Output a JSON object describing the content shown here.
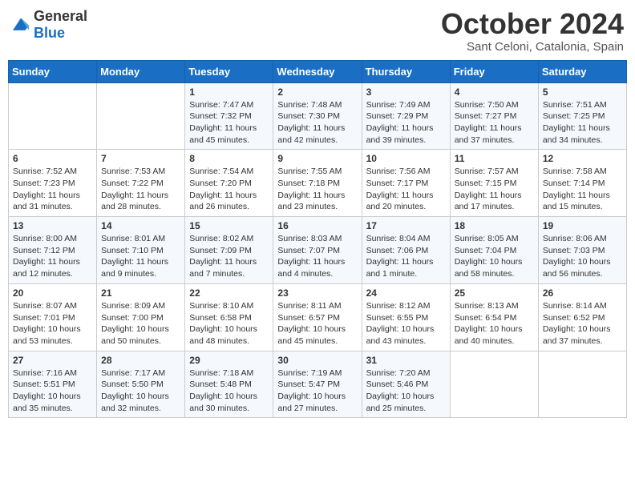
{
  "header": {
    "logo": {
      "general": "General",
      "blue": "Blue"
    },
    "month": "October 2024",
    "location": "Sant Celoni, Catalonia, Spain"
  },
  "weekdays": [
    "Sunday",
    "Monday",
    "Tuesday",
    "Wednesday",
    "Thursday",
    "Friday",
    "Saturday"
  ],
  "weeks": [
    [
      {
        "day": "",
        "sunrise": "",
        "sunset": "",
        "daylight": ""
      },
      {
        "day": "",
        "sunrise": "",
        "sunset": "",
        "daylight": ""
      },
      {
        "day": "1",
        "sunrise": "Sunrise: 7:47 AM",
        "sunset": "Sunset: 7:32 PM",
        "daylight": "Daylight: 11 hours and 45 minutes."
      },
      {
        "day": "2",
        "sunrise": "Sunrise: 7:48 AM",
        "sunset": "Sunset: 7:30 PM",
        "daylight": "Daylight: 11 hours and 42 minutes."
      },
      {
        "day": "3",
        "sunrise": "Sunrise: 7:49 AM",
        "sunset": "Sunset: 7:29 PM",
        "daylight": "Daylight: 11 hours and 39 minutes."
      },
      {
        "day": "4",
        "sunrise": "Sunrise: 7:50 AM",
        "sunset": "Sunset: 7:27 PM",
        "daylight": "Daylight: 11 hours and 37 minutes."
      },
      {
        "day": "5",
        "sunrise": "Sunrise: 7:51 AM",
        "sunset": "Sunset: 7:25 PM",
        "daylight": "Daylight: 11 hours and 34 minutes."
      }
    ],
    [
      {
        "day": "6",
        "sunrise": "Sunrise: 7:52 AM",
        "sunset": "Sunset: 7:23 PM",
        "daylight": "Daylight: 11 hours and 31 minutes."
      },
      {
        "day": "7",
        "sunrise": "Sunrise: 7:53 AM",
        "sunset": "Sunset: 7:22 PM",
        "daylight": "Daylight: 11 hours and 28 minutes."
      },
      {
        "day": "8",
        "sunrise": "Sunrise: 7:54 AM",
        "sunset": "Sunset: 7:20 PM",
        "daylight": "Daylight: 11 hours and 26 minutes."
      },
      {
        "day": "9",
        "sunrise": "Sunrise: 7:55 AM",
        "sunset": "Sunset: 7:18 PM",
        "daylight": "Daylight: 11 hours and 23 minutes."
      },
      {
        "day": "10",
        "sunrise": "Sunrise: 7:56 AM",
        "sunset": "Sunset: 7:17 PM",
        "daylight": "Daylight: 11 hours and 20 minutes."
      },
      {
        "day": "11",
        "sunrise": "Sunrise: 7:57 AM",
        "sunset": "Sunset: 7:15 PM",
        "daylight": "Daylight: 11 hours and 17 minutes."
      },
      {
        "day": "12",
        "sunrise": "Sunrise: 7:58 AM",
        "sunset": "Sunset: 7:14 PM",
        "daylight": "Daylight: 11 hours and 15 minutes."
      }
    ],
    [
      {
        "day": "13",
        "sunrise": "Sunrise: 8:00 AM",
        "sunset": "Sunset: 7:12 PM",
        "daylight": "Daylight: 11 hours and 12 minutes."
      },
      {
        "day": "14",
        "sunrise": "Sunrise: 8:01 AM",
        "sunset": "Sunset: 7:10 PM",
        "daylight": "Daylight: 11 hours and 9 minutes."
      },
      {
        "day": "15",
        "sunrise": "Sunrise: 8:02 AM",
        "sunset": "Sunset: 7:09 PM",
        "daylight": "Daylight: 11 hours and 7 minutes."
      },
      {
        "day": "16",
        "sunrise": "Sunrise: 8:03 AM",
        "sunset": "Sunset: 7:07 PM",
        "daylight": "Daylight: 11 hours and 4 minutes."
      },
      {
        "day": "17",
        "sunrise": "Sunrise: 8:04 AM",
        "sunset": "Sunset: 7:06 PM",
        "daylight": "Daylight: 11 hours and 1 minute."
      },
      {
        "day": "18",
        "sunrise": "Sunrise: 8:05 AM",
        "sunset": "Sunset: 7:04 PM",
        "daylight": "Daylight: 10 hours and 58 minutes."
      },
      {
        "day": "19",
        "sunrise": "Sunrise: 8:06 AM",
        "sunset": "Sunset: 7:03 PM",
        "daylight": "Daylight: 10 hours and 56 minutes."
      }
    ],
    [
      {
        "day": "20",
        "sunrise": "Sunrise: 8:07 AM",
        "sunset": "Sunset: 7:01 PM",
        "daylight": "Daylight: 10 hours and 53 minutes."
      },
      {
        "day": "21",
        "sunrise": "Sunrise: 8:09 AM",
        "sunset": "Sunset: 7:00 PM",
        "daylight": "Daylight: 10 hours and 50 minutes."
      },
      {
        "day": "22",
        "sunrise": "Sunrise: 8:10 AM",
        "sunset": "Sunset: 6:58 PM",
        "daylight": "Daylight: 10 hours and 48 minutes."
      },
      {
        "day": "23",
        "sunrise": "Sunrise: 8:11 AM",
        "sunset": "Sunset: 6:57 PM",
        "daylight": "Daylight: 10 hours and 45 minutes."
      },
      {
        "day": "24",
        "sunrise": "Sunrise: 8:12 AM",
        "sunset": "Sunset: 6:55 PM",
        "daylight": "Daylight: 10 hours and 43 minutes."
      },
      {
        "day": "25",
        "sunrise": "Sunrise: 8:13 AM",
        "sunset": "Sunset: 6:54 PM",
        "daylight": "Daylight: 10 hours and 40 minutes."
      },
      {
        "day": "26",
        "sunrise": "Sunrise: 8:14 AM",
        "sunset": "Sunset: 6:52 PM",
        "daylight": "Daylight: 10 hours and 37 minutes."
      }
    ],
    [
      {
        "day": "27",
        "sunrise": "Sunrise: 7:16 AM",
        "sunset": "Sunset: 5:51 PM",
        "daylight": "Daylight: 10 hours and 35 minutes."
      },
      {
        "day": "28",
        "sunrise": "Sunrise: 7:17 AM",
        "sunset": "Sunset: 5:50 PM",
        "daylight": "Daylight: 10 hours and 32 minutes."
      },
      {
        "day": "29",
        "sunrise": "Sunrise: 7:18 AM",
        "sunset": "Sunset: 5:48 PM",
        "daylight": "Daylight: 10 hours and 30 minutes."
      },
      {
        "day": "30",
        "sunrise": "Sunrise: 7:19 AM",
        "sunset": "Sunset: 5:47 PM",
        "daylight": "Daylight: 10 hours and 27 minutes."
      },
      {
        "day": "31",
        "sunrise": "Sunrise: 7:20 AM",
        "sunset": "Sunset: 5:46 PM",
        "daylight": "Daylight: 10 hours and 25 minutes."
      },
      {
        "day": "",
        "sunrise": "",
        "sunset": "",
        "daylight": ""
      },
      {
        "day": "",
        "sunrise": "",
        "sunset": "",
        "daylight": ""
      }
    ]
  ]
}
